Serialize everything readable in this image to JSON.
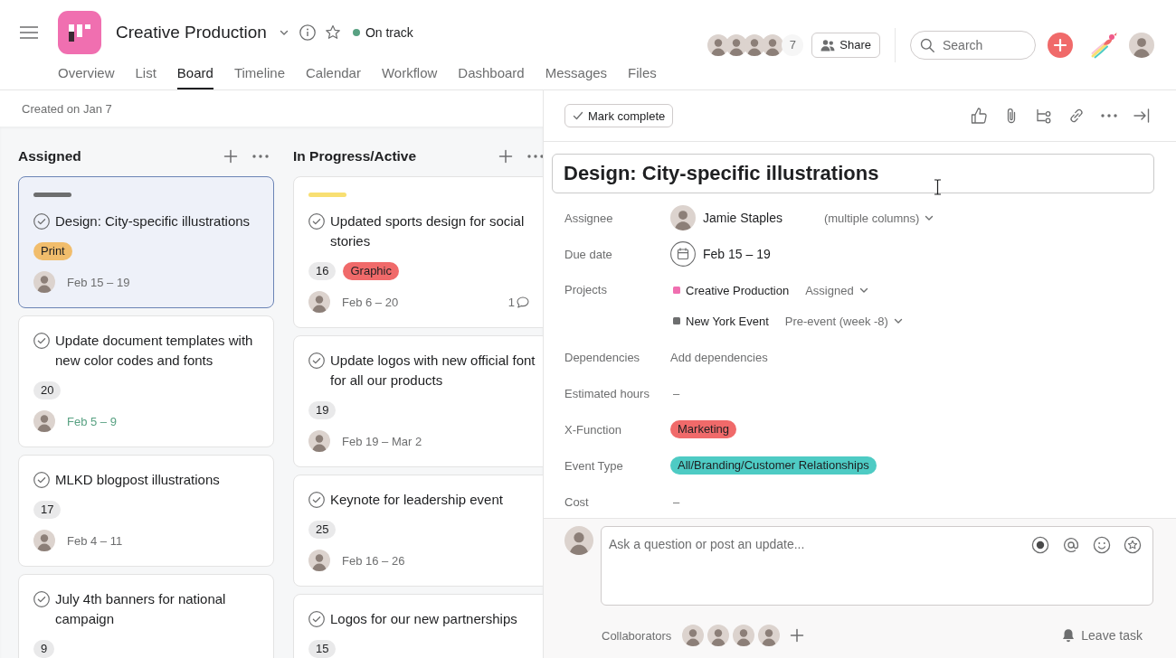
{
  "project": {
    "title": "Creative Production",
    "status": {
      "label": "On track",
      "color": "#58a182"
    }
  },
  "tabs": [
    {
      "label": "Overview",
      "selected": false
    },
    {
      "label": "List",
      "selected": false
    },
    {
      "label": "Board",
      "selected": true
    },
    {
      "label": "Timeline",
      "selected": false
    },
    {
      "label": "Calendar",
      "selected": false
    },
    {
      "label": "Workflow",
      "selected": false
    },
    {
      "label": "Dashboard",
      "selected": false
    },
    {
      "label": "Messages",
      "selected": false
    },
    {
      "label": "Files",
      "selected": false
    }
  ],
  "members": {
    "avatars": [
      {
        "kind": "photo"
      },
      {
        "kind": "photo"
      },
      {
        "kind": "photo"
      },
      {
        "kind": "photo"
      }
    ],
    "more": "7"
  },
  "share_button": "Share",
  "search": {
    "placeholder": "Search"
  },
  "account": {
    "kind": "photo"
  },
  "board": {
    "created": "Created on Jan 7",
    "columns": [
      {
        "title": "Assigned",
        "cards": [
          {
            "title": "Design: City-specific illustrations",
            "selected": true,
            "completed": false,
            "color": "#6d6e6f",
            "tags": [
              {
                "label": "Print",
                "color": "#f1bd6c"
              }
            ],
            "assignee": {
              "kind": "photo"
            },
            "date": "Feb 15 – 19",
            "date_highlighted": false
          },
          {
            "title": "Update document templates with new color codes and fonts",
            "selected": false,
            "completed": false,
            "number": "20",
            "assignee": {
              "kind": "photo"
            },
            "date": "Feb 5 – 9",
            "date_highlighted": true
          },
          {
            "title": "MLKD blogpost illustrations",
            "selected": false,
            "completed": false,
            "number": "17",
            "assignee": {
              "kind": "photo"
            },
            "date": "Feb 4 – 11",
            "date_highlighted": false
          },
          {
            "title": "July 4th banners for national campaign",
            "selected": false,
            "completed": false,
            "number": "9"
          }
        ]
      },
      {
        "title": "In Progress/Active",
        "cards": [
          {
            "title": "Updated sports design for social stories",
            "selected": false,
            "completed": false,
            "color": "#f8df72",
            "number": "16",
            "tags": [
              {
                "label": "Graphic",
                "color": "#f06a6a"
              }
            ],
            "assignee": {
              "kind": "photo"
            },
            "date": "Feb 6 – 20",
            "date_highlighted": false,
            "comments": "1"
          },
          {
            "title": "Update logos with new official font for all our products",
            "selected": false,
            "completed": false,
            "number": "19",
            "assignee": {
              "kind": "photo"
            },
            "date": "Feb 19 – Mar 2",
            "date_highlighted": false
          },
          {
            "title": "Keynote for leadership event",
            "selected": false,
            "completed": false,
            "number": "25",
            "assignee": {
              "kind": "photo"
            },
            "date": "Feb 16 – 26",
            "date_highlighted": false
          },
          {
            "title": "Logos for our new partnerships",
            "selected": false,
            "completed": false,
            "number": "15"
          }
        ]
      }
    ]
  },
  "task": {
    "mark_complete": "Mark complete",
    "title": "Design: City-specific illustrations",
    "fields": [
      {
        "kind": "person",
        "label": "Assignee",
        "avatar": {
          "kind": "photo"
        },
        "value": "Jamie Staples",
        "column_picker": "(multiple columns)"
      },
      {
        "kind": "date",
        "label": "Due date",
        "value": "Feb 15 – 19"
      },
      {
        "kind": "projects",
        "label": "Projects",
        "projects": [
          {
            "name": "Creative Production",
            "color": "#f06fb0",
            "section": "Assigned"
          },
          {
            "name": "New York Event",
            "color": "#6d6e6f",
            "section": "Pre-event (week -8)"
          }
        ]
      },
      {
        "kind": "action",
        "label": "Dependencies",
        "value": "Add dependencies"
      },
      {
        "kind": "text",
        "label": "Estimated hours",
        "value": "–"
      },
      {
        "kind": "tag",
        "label": "X-Function",
        "value": "Marketing",
        "color": "#f06a6a"
      },
      {
        "kind": "tag",
        "label": "Event Type",
        "value": "All/Branding/Customer Relationships",
        "color": "#4ecbc4"
      },
      {
        "kind": "text",
        "label": "Cost",
        "value": "–"
      }
    ],
    "comment": {
      "avatar": {
        "kind": "photo"
      },
      "placeholder": "Ask a question or post an update..."
    },
    "collaborators": {
      "label": "Collaborators",
      "avatars": [
        {
          "kind": "photo"
        },
        {
          "kind": "photo"
        },
        {
          "kind": "photo"
        },
        {
          "kind": "photo"
        }
      ]
    },
    "leave_task": "Leave task"
  }
}
